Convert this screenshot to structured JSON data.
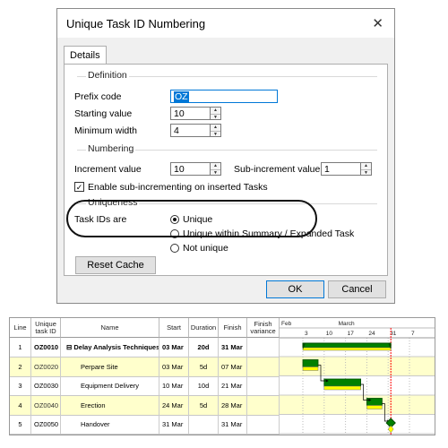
{
  "dialog": {
    "title": "Unique Task ID Numbering",
    "close_glyph": "✕",
    "tab": "Details",
    "definition": {
      "heading": "Definition",
      "prefix_label": "Prefix code",
      "prefix_value": "OZ",
      "starting_label": "Starting value",
      "starting_value": "10",
      "minwidth_label": "Minimum width",
      "minwidth_value": "4"
    },
    "numbering": {
      "heading": "Numbering",
      "increment_label": "Increment value",
      "increment_value": "10",
      "subincrement_label": "Sub-increment value",
      "subincrement_value": "1",
      "enable_sub_label": "Enable sub-incrementing on inserted Tasks",
      "enable_sub_checked": true
    },
    "uniqueness": {
      "heading": "Uniqueness",
      "taskids_label": "Task IDs are",
      "options": [
        "Unique",
        "Unique within Summary / Expanded Task",
        "Not unique"
      ],
      "selected": "Unique"
    },
    "reset_cache": "Reset Cache",
    "ok": "OK",
    "cancel": "Cancel"
  },
  "gantt": {
    "headers": {
      "line": "Line",
      "unique_id": "Unique task ID",
      "name": "Name",
      "start": "Start",
      "duration": "Duration",
      "finish": "Finish",
      "finish_variance": "Finish variance"
    },
    "timeline": {
      "month1": "Feb",
      "month2": "March",
      "days": [
        "3",
        "10",
        "17",
        "24",
        "31",
        "7"
      ]
    },
    "rows": [
      {
        "line": "1",
        "id": "OZ0010",
        "name": "Delay Analysis Techniques",
        "start": "03 Mar",
        "duration": "20d",
        "finish": "31 Mar",
        "summary": true
      },
      {
        "line": "2",
        "id": "OZ0020",
        "name": "Perpare Site",
        "start": "03 Mar",
        "duration": "5d",
        "finish": "07 Mar"
      },
      {
        "line": "3",
        "id": "OZ0030",
        "name": "Equipment Delivery",
        "start": "10 Mar",
        "duration": "10d",
        "finish": "21 Mar"
      },
      {
        "line": "4",
        "id": "OZ0040",
        "name": "Erection",
        "start": "24 Mar",
        "duration": "5d",
        "finish": "28 Mar"
      },
      {
        "line": "5",
        "id": "OZ0050",
        "name": "Handover",
        "start": "31 Mar",
        "duration": "",
        "finish": "31 Mar"
      }
    ],
    "colors": {
      "bar": "#008000",
      "baseline": "#ffff00",
      "row_highlight": "#ffffcc",
      "progress_line": "#ff0000"
    }
  }
}
